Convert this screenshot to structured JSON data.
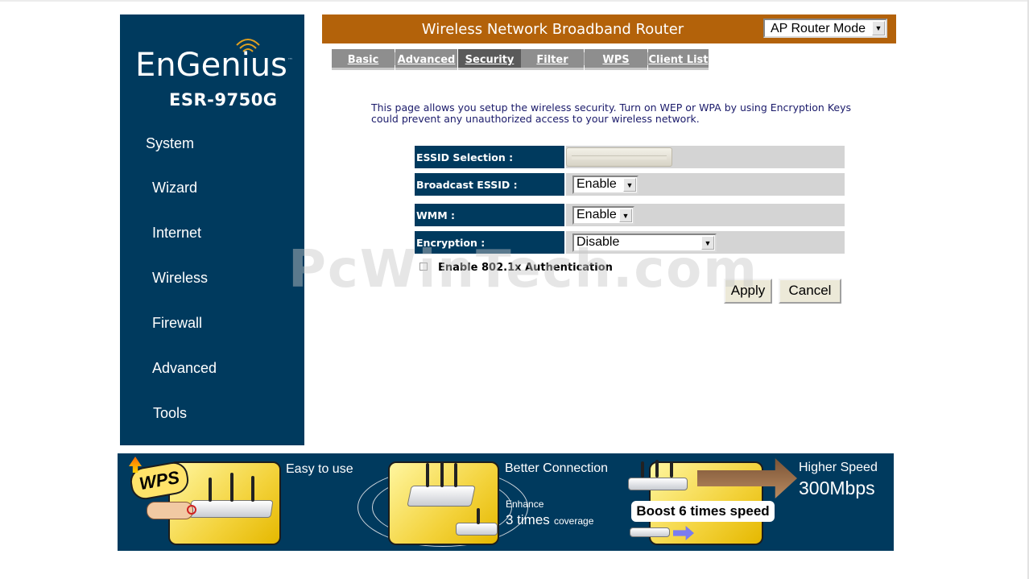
{
  "brand": {
    "logo_text": "EnGenius",
    "model": "ESR-9750G"
  },
  "sidebar": {
    "items": [
      {
        "label": "System"
      },
      {
        "label": "Wizard"
      },
      {
        "label": "Internet"
      },
      {
        "label": "Wireless"
      },
      {
        "label": "Firewall"
      },
      {
        "label": "Advanced"
      },
      {
        "label": "Tools"
      }
    ]
  },
  "header": {
    "title": "Wireless Network Broadband Router",
    "mode_value": "AP Router Mode"
  },
  "tabs": [
    {
      "label": "Basic"
    },
    {
      "label": "Advanced"
    },
    {
      "label": "Security",
      "active": true
    },
    {
      "label": "Filter"
    },
    {
      "label": "WPS"
    },
    {
      "label": "Client List"
    }
  ],
  "main": {
    "description": "This page allows you setup the wireless security. Turn on WEP or WPA by using Encryption Keys could prevent any unauthorized access to your wireless network.",
    "fields": {
      "essid_label": "ESSID Selection :",
      "broadcast_label": "Broadcast ESSID :",
      "broadcast_value": "Enable",
      "wmm_label": "WMM :",
      "wmm_value": "Enable",
      "encryption_label": "Encryption :",
      "encryption_value": "Disable"
    },
    "auth_checkbox": {
      "label": "Enable 802.1x Authentication",
      "checked": false
    },
    "apply_label": "Apply",
    "cancel_label": "Cancel"
  },
  "watermark": "PcWinTech.com",
  "banner": {
    "wps_badge": "WPS",
    "easy": "Easy to use",
    "better": "Better Connection",
    "enhance": "Enhance",
    "times_num": "3 times",
    "coverage": "coverage",
    "boost": "Boost 6 times speed",
    "higher": "Higher Speed",
    "speed": "300Mbps"
  },
  "colors": {
    "navy": "#003a5e",
    "header_orange": "#b3620a",
    "tab_gray": "#8e8e8e",
    "value_gray": "#d4d4d4"
  }
}
